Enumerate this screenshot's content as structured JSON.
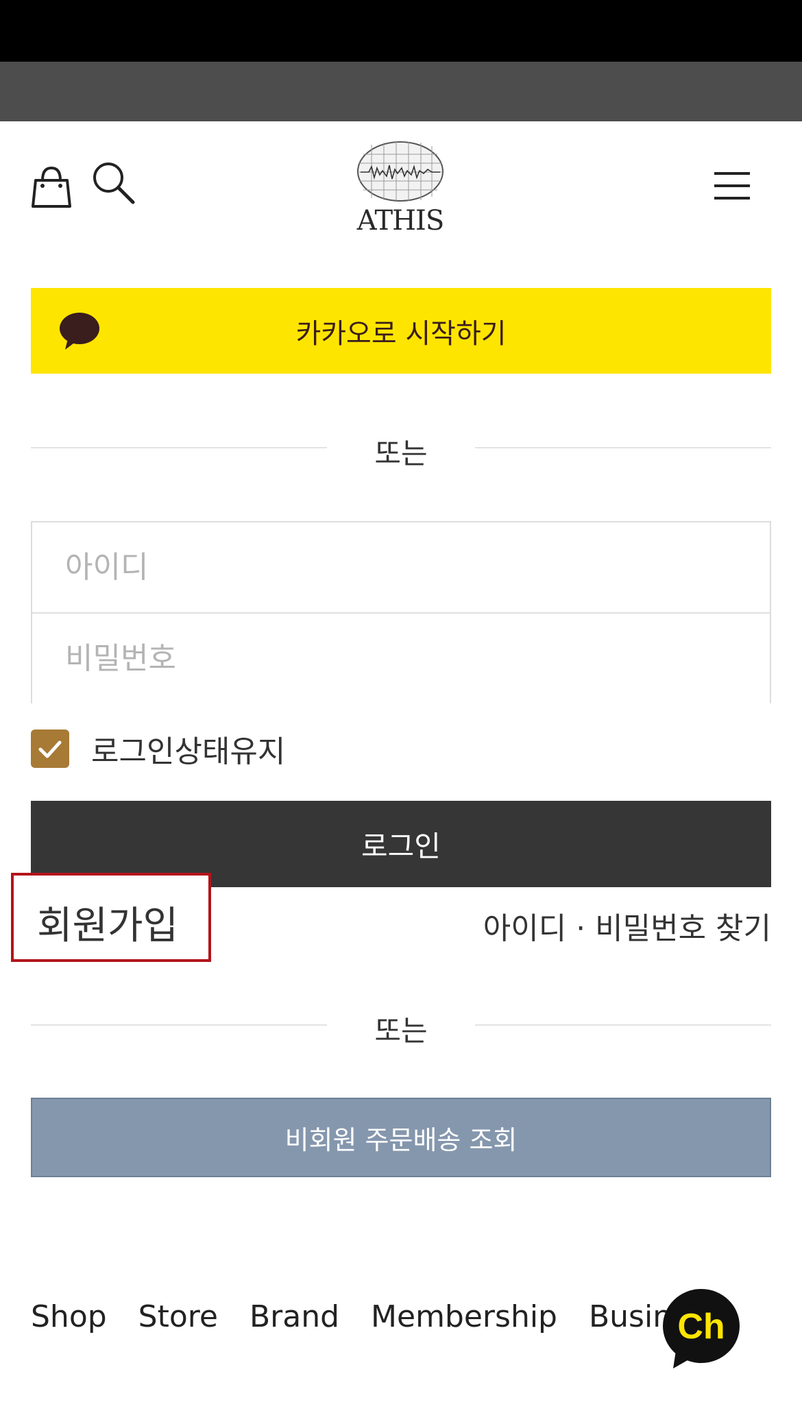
{
  "header": {
    "logo_text": "ATHIS",
    "icons": {
      "cart": "shopping-bag-icon",
      "search": "search-icon",
      "menu": "hamburger-menu-icon"
    }
  },
  "kakao": {
    "label": "카카오로 시작하기",
    "icon": "speech-bubble-icon",
    "color": "#fee500"
  },
  "divider_text": "또는",
  "login_form": {
    "id_placeholder": "아이디",
    "password_placeholder": "비밀번호",
    "keep_login_label": "로그인상태유지",
    "keep_login_checked": true,
    "login_button": "로그인"
  },
  "links": {
    "signup": "회원가입",
    "find_account": "아이디 · 비밀번호 찾기"
  },
  "guest_order": {
    "label": "비회원 주문배송 조회"
  },
  "footer_nav": [
    "Shop",
    "Store",
    "Brand",
    "Membership",
    "Business"
  ],
  "channel_button": {
    "label": "Ch",
    "icon": "kakao-channel-icon"
  },
  "colors": {
    "kakao": "#fee500",
    "login": "#363636",
    "guest": "#8597ad",
    "checkbox": "#a77a35",
    "highlight": "#b3141b"
  }
}
